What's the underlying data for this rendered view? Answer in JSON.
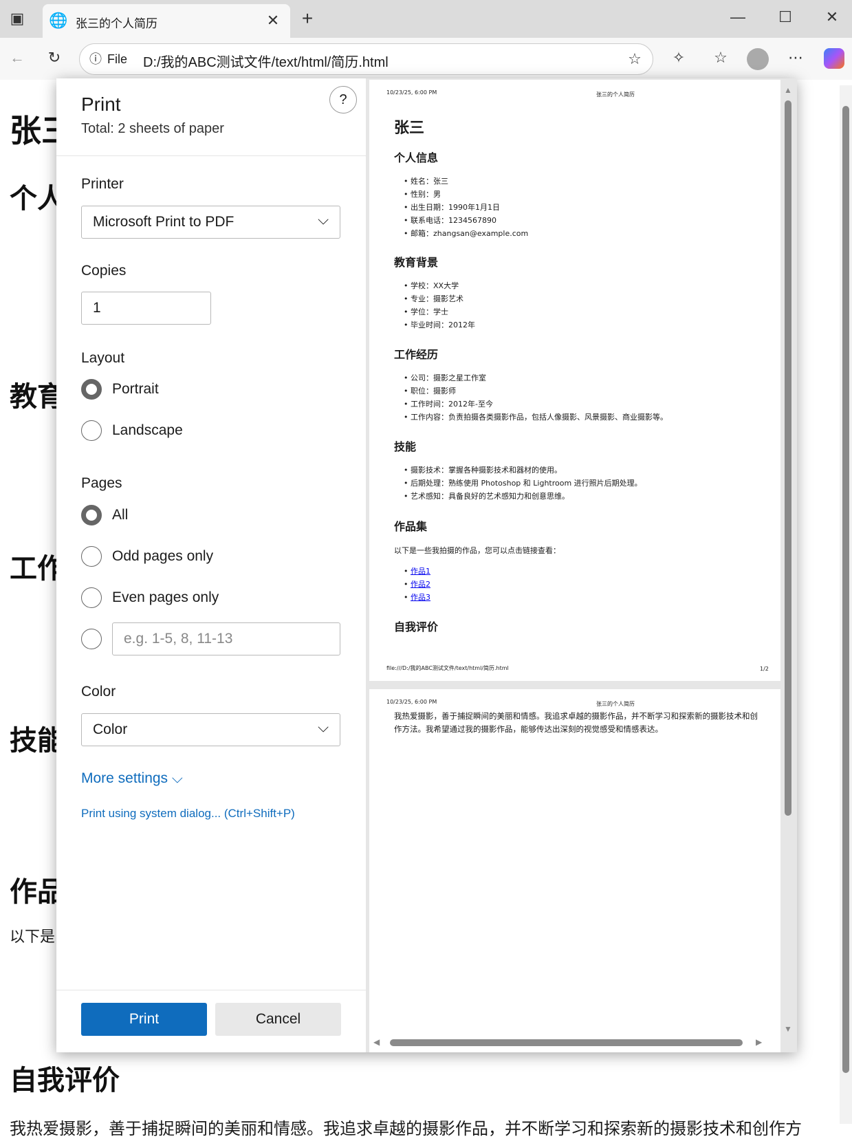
{
  "browser": {
    "tab_title": "张三的个人简历",
    "file_label": "File",
    "url": "D:/我的ABC测试文件/text/html/简历.html"
  },
  "background": {
    "name_partial": "张三",
    "headings": [
      "个人",
      "教育",
      "工作",
      "技能",
      "作品"
    ],
    "intro_partial": "以下是",
    "self_eval": "自我评价",
    "self_eval_text": "我热爱摄影，善于捕捉瞬间的美丽和情感。我追求卓越的摄影作品，并不断学习和探索新的摄影技术和创作方"
  },
  "print": {
    "title": "Print",
    "total": "Total: 2 sheets of paper",
    "help": "?",
    "printer_label": "Printer",
    "printer_value": "Microsoft Print to PDF",
    "copies_label": "Copies",
    "copies_value": "1",
    "layout_label": "Layout",
    "portrait": "Portrait",
    "landscape": "Landscape",
    "pages_label": "Pages",
    "all": "All",
    "odd": "Odd pages only",
    "even": "Even pages only",
    "range_placeholder": "e.g. 1-5, 8, 11-13",
    "color_label": "Color",
    "color_value": "Color",
    "more_settings": "More settings",
    "system_dialog": "Print using system dialog... (Ctrl+Shift+P)",
    "print_button": "Print",
    "cancel_button": "Cancel"
  },
  "preview": {
    "date": "10/23/25, 6:00 PM",
    "header_title": "张三的个人简历",
    "footer_url": "file:///D:/我的ABC测试文件/text/html/简历.html",
    "page_num": "1/2",
    "name": "张三",
    "sections": [
      {
        "title": "个人信息",
        "items": [
          "姓名：张三",
          "性别：男",
          "出生日期：1990年1月1日",
          "联系电话：1234567890",
          "邮箱：zhangsan@example.com"
        ]
      },
      {
        "title": "教育背景",
        "items": [
          "学校：XX大学",
          "专业：摄影艺术",
          "学位：学士",
          "毕业时间：2012年"
        ]
      },
      {
        "title": "工作经历",
        "items": [
          "公司：摄影之星工作室",
          "职位：摄影师",
          "工作时间：2012年-至今",
          "工作内容：负责拍摄各类摄影作品，包括人像摄影、风景摄影、商业摄影等。"
        ]
      },
      {
        "title": "技能",
        "items": [
          "摄影技术：掌握各种摄影技术和器材的使用。",
          "后期处理：熟练使用 Photoshop 和 Lightroom 进行照片后期处理。",
          "艺术感知：具备良好的艺术感知力和创意思维。"
        ]
      },
      {
        "title": "作品集",
        "intro": "以下是一些我拍摄的作品，您可以点击链接查看：",
        "links": [
          "作品1",
          "作品2",
          "作品3"
        ]
      },
      {
        "title": "自我评价"
      }
    ],
    "self_eval_text": "我热爱摄影，善于捕捉瞬间的美丽和情感。我追求卓越的摄影作品，并不断学习和探索新的摄影技术和创作方法。我希望通过我的摄影作品，能够传达出深刻的视觉感受和情感表达。"
  }
}
